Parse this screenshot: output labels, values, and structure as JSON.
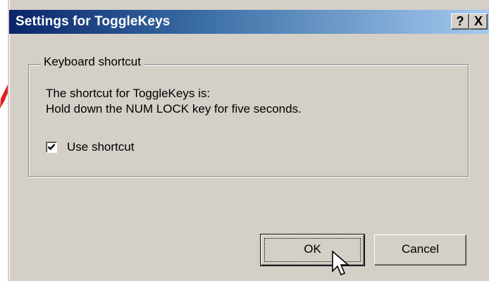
{
  "window": {
    "title": "Settings for ToggleKeys",
    "help_label": "?",
    "close_label": "X"
  },
  "group": {
    "label": "Keyboard shortcut",
    "description_line1": "The shortcut for ToggleKeys is:",
    "description_line2": "Hold down the NUM LOCK key for five seconds."
  },
  "use_shortcut": {
    "label": "Use shortcut",
    "checked": true
  },
  "buttons": {
    "ok_label": "OK",
    "cancel_label": "Cancel"
  },
  "colors": {
    "dialog_face": "#d4d0c8",
    "title_start": "#0a246a",
    "title_end": "#a6caf0",
    "annotation_arrow": "#e02020"
  },
  "icons": {
    "check": "check-icon",
    "cursor": "mouse-pointer-icon",
    "annotation": "red-arrow-icon"
  }
}
